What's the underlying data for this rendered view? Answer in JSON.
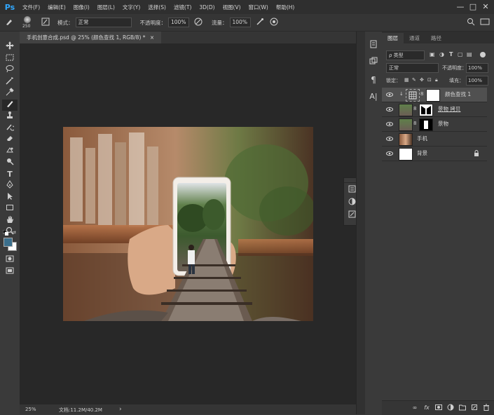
{
  "app": {
    "logo": "Ps"
  },
  "menu": [
    "文件(F)",
    "编辑(E)",
    "图像(I)",
    "图层(L)",
    "文字(Y)",
    "选择(S)",
    "滤镜(T)",
    "3D(D)",
    "视图(V)",
    "窗口(W)",
    "帮助(H)"
  ],
  "window_controls": {
    "minimize": "—",
    "maximize": "□",
    "close": "✕"
  },
  "options": {
    "brush_size": "250",
    "mode_label": "模式：",
    "mode_value": "正常",
    "opacity_label": "不透明度：",
    "opacity_value": "100%",
    "flow_label": "流量：",
    "flow_value": "100%"
  },
  "document": {
    "tab_title": "手机创意合成.psd @ 25% (颜色查找 1, RGB/8) *",
    "tab_close": "×"
  },
  "status": {
    "zoom": "25%",
    "doc_info": "文档:11.2M/40.2M",
    "arrow": "›"
  },
  "layers_panel": {
    "tabs": [
      "图层",
      "通道",
      "路径"
    ],
    "filter_label": "ρ 类型",
    "blend_mode": "正常",
    "opacity_label": "不透明度：",
    "opacity_value": "100%",
    "lock_label": "锁定：",
    "fill_label": "填充：",
    "fill_value": "100%",
    "layers": [
      {
        "name": "颜色查找 1",
        "selected": true,
        "kind": "adjustment"
      },
      {
        "name": "景物 拷贝",
        "selected": false,
        "kind": "masked"
      },
      {
        "name": "景物",
        "selected": false,
        "kind": "masked"
      },
      {
        "name": "手机",
        "selected": false,
        "kind": "image"
      },
      {
        "name": "背景",
        "selected": false,
        "kind": "locked"
      }
    ]
  },
  "icons": {
    "eye": "eye-icon",
    "lock": "lock-icon",
    "link": "link-icon"
  },
  "colors": {
    "foreground": "#3b6f8c",
    "background": "#ffffff",
    "accent": "#31a8ff"
  }
}
